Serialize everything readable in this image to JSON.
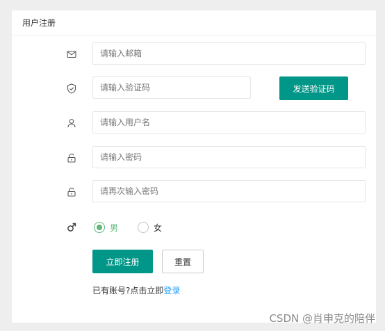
{
  "header": {
    "title": "用户注册"
  },
  "form": {
    "email_placeholder": "请输入邮箱",
    "code_placeholder": "请输入验证码",
    "send_code_label": "发送验证码",
    "username_placeholder": "请输入用户名",
    "password_placeholder": "请输入密码",
    "confirm_password_placeholder": "请再次输入密码",
    "gender": {
      "options": [
        "男",
        "女"
      ],
      "selected": "男"
    },
    "submit_label": "立即注册",
    "reset_label": "重置"
  },
  "footer": {
    "prompt": "已有账号?点击立即",
    "login_link": "登录"
  },
  "watermark": "CSDN @肖申克的陪伴",
  "icons": {
    "email": "envelope-icon",
    "code": "shield-check-icon",
    "username": "user-icon",
    "password": "lock-icon",
    "confirm_password": "lock-icon",
    "gender": "male-symbol-icon"
  },
  "colors": {
    "primary": "#009688",
    "radio_checked": "#5fb878",
    "link": "#1e9fff"
  }
}
